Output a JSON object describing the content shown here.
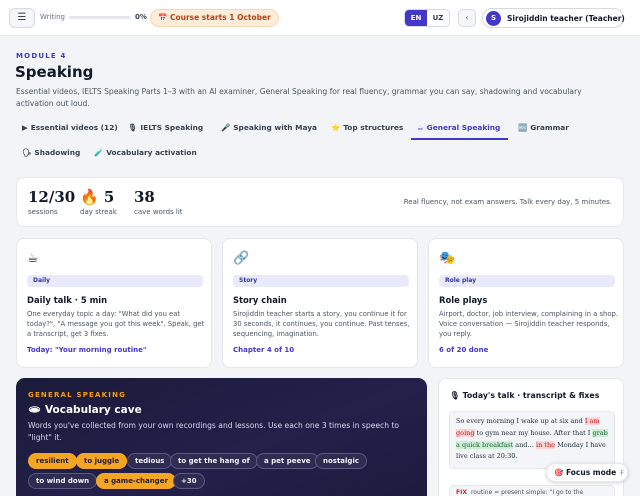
{
  "topbar": {
    "menu_icon": "☰",
    "writing_label": "Writing",
    "writing_progress": 0,
    "writing_percent": "0%",
    "course_badge": "📅 Course starts 1 October",
    "languages": [
      "EN",
      "UZ"
    ],
    "active_language": "EN",
    "back_icon": "‹",
    "avatar_letter": "S",
    "user_name": "Sirojiddin teacher (Teacher)"
  },
  "header": {
    "module": "MODULE 4",
    "title": "Speaking",
    "description": "Essential videos, IELTS Speaking Parts 1–3 with an AI examiner, General Speaking for real fluency, grammar you can say, shadowing and vocabulary activation out loud."
  },
  "tabs": [
    {
      "icon": "▶",
      "label": "Essential videos (12)"
    },
    {
      "icon": "🎙",
      "label": "IELTS Speaking"
    },
    {
      "icon": "🎤",
      "label": "Speaking with Maya"
    },
    {
      "icon": "⭐",
      "label": "Top structures"
    },
    {
      "icon": "☕",
      "label": "General Speaking",
      "active": true
    },
    {
      "icon": "🔤",
      "label": "Grammar"
    },
    {
      "icon": "🗣",
      "label": "Shadowing"
    },
    {
      "icon": "🧪",
      "label": "Vocabulary activation"
    }
  ],
  "stats": {
    "sessions_value": "12/30",
    "sessions_label": "sessions",
    "streak_icon": "🔥",
    "streak_value": "5",
    "streak_label": "day streak",
    "words_value": "38",
    "words_label": "cave words lit",
    "note": "Real fluency, not exam answers. Talk every day, 5 minutes."
  },
  "activities": [
    {
      "icon": "☕",
      "badge": "Daily",
      "title": "Daily talk · 5 min",
      "desc": "One everyday topic a day: \"What did you eat today?\", \"A message you got this week\". Speak, get a transcript, get 3 fixes.",
      "link": "Today: \"Your morning routine\""
    },
    {
      "icon": "🔗",
      "badge": "Story",
      "title": "Story chain",
      "desc": "Sirojiddin teacher starts a story, you continue it for 30 seconds, it continues, you continue. Past tenses, sequencing, imagination.",
      "link": "Chapter 4 of 10"
    },
    {
      "icon": "🎭",
      "badge": "Role play",
      "title": "Role plays",
      "desc": "Airport, doctor, job interview, complaining in a shop. Voice conversation — Sirojiddin teacher responds, you reply.",
      "link": "6 of 20 done"
    }
  ],
  "cave": {
    "kicker": "GENERAL SPEAKING",
    "title": "🕳 Vocabulary cave",
    "description": "Words you've collected from your own recordings and lessons. Use each one 3 times in speech to \"light\" it.",
    "chips": [
      {
        "label": "resilient",
        "lit": true
      },
      {
        "label": "to juggle",
        "lit": true
      },
      {
        "label": "tedious",
        "lit": false
      },
      {
        "label": "to get the hang of",
        "lit": false
      },
      {
        "label": "a pet peeve",
        "lit": false
      },
      {
        "label": "nostalgic",
        "lit": false
      },
      {
        "label": "to wind down",
        "lit": false
      },
      {
        "label": "a game-changer",
        "lit": true
      },
      {
        "label": "+30",
        "lit": false
      }
    ]
  },
  "talk": {
    "title": "🎙 Today's talk · transcript & fixes",
    "t1": "So every morning I wake up at six and ",
    "t2": "I am going",
    "t3": " to gym near my house. After that I ",
    "t4": "grab a quick breakfast",
    "t5": " and… ",
    "t6": "in the",
    "t7": " Monday I have live class at 20:30.",
    "fix_tag": "FIX",
    "fix_text": "routine = present simple: \"I go to the"
  },
  "focus": {
    "label": "🎯 Focus mode",
    "key": "F"
  },
  "colors": {
    "accent": "#4338ca",
    "gold": "#f5a524",
    "cave_bg": "#1b1b3a"
  }
}
